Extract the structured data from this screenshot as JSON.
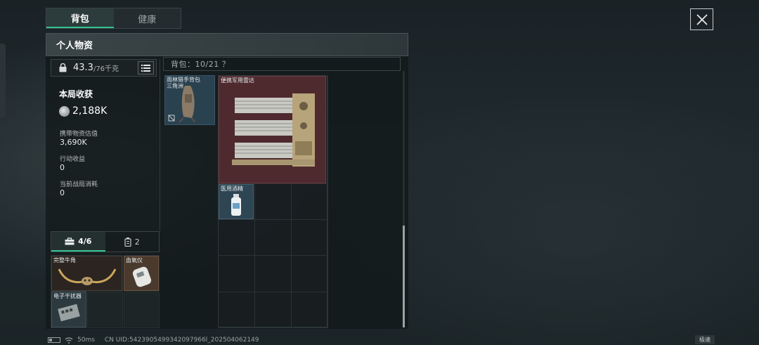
{
  "tabs": [
    {
      "label": "背包",
      "active": true
    },
    {
      "label": "健康",
      "active": false
    }
  ],
  "panel": {
    "title": "个人物资",
    "weight": {
      "current": "43.3",
      "max": "/76千克"
    },
    "loot": {
      "title": "本局收获",
      "value": "2,188K"
    },
    "stats": [
      {
        "label": "携带物资估值",
        "value": "3,690K"
      },
      {
        "label": "行动收益",
        "value": "0"
      },
      {
        "label": "当前战局消耗",
        "value": "0"
      }
    ],
    "secure_tabs": [
      {
        "label": "4/6",
        "icon": "toolbox-icon",
        "active": true
      },
      {
        "label": "2",
        "icon": "canister-icon",
        "active": false
      }
    ],
    "secure_items": [
      {
        "name": "完整牛角",
        "icon": "horn-icon"
      },
      {
        "name": "血氧仪",
        "icon": "oximeter-icon"
      },
      {
        "name": "电子干扰器",
        "icon": "jammer-icon"
      }
    ]
  },
  "backpack": {
    "header": "背包：10/21 ？",
    "rig": {
      "name": "雨林猎手背包\n三角洲",
      "icon": "backpack-icon"
    },
    "items": [
      {
        "name": "便携军用雷达",
        "icon": "radar-icon",
        "rarity_color": "#4e2a2e"
      },
      {
        "name": "医用酒精",
        "icon": "alcohol-bottle-icon",
        "rarity_color": "#2e4654"
      }
    ]
  },
  "statusbar": {
    "ping": "50ms",
    "uid": "CN UID:5423905499342097966l_202504062149",
    "speed": "极速"
  },
  "colors": {
    "accent": "#35c38f",
    "red_rarity": "#4e2a2e",
    "blue_rarity": "#2a4150",
    "gold_rarity": "#4a3a2e"
  }
}
